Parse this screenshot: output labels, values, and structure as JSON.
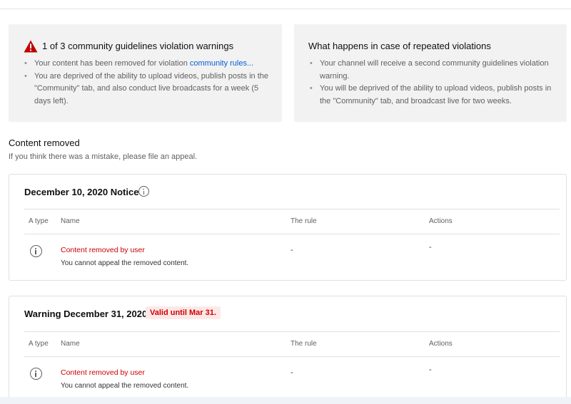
{
  "warning_box": {
    "title": "1 of 3 community guidelines violation warnings",
    "bullet1_text": "Your content has been removed for violation ",
    "bullet1_link": "community rules...",
    "bullet2": "You are deprived of the ability to upload videos, publish posts in the \"Community\" tab, and also conduct live broadcasts for a week (5 days left)."
  },
  "repeat_box": {
    "title": "What happens in case of repeated violations",
    "bullet1": "Your channel will receive a second community guidelines violation warning.",
    "bullet2": "You will be deprived of the ability to upload videos, publish posts in the \"Community\" tab, and broadcast live for two weeks."
  },
  "content_removed": {
    "title": "Content removed",
    "subtitle": "If you think there was a mistake, please file an appeal."
  },
  "table_headers": {
    "type": "A type",
    "name": "Name",
    "rule": "The rule",
    "actions": "Actions"
  },
  "notices": [
    {
      "title": "December 10, 2020 Notice",
      "row": {
        "title": "Content removed by user",
        "subtitle": "You cannot appeal the removed content.",
        "rule": "-",
        "actions": "-"
      }
    },
    {
      "title": "Warning December 31, 2020",
      "badge": "Valid until Mar 31.",
      "row": {
        "title": "Content removed by user",
        "subtitle": "You cannot appeal the removed content.",
        "rule": "-",
        "actions": "-"
      }
    }
  ],
  "icons": {
    "warning": "warning-triangle-icon",
    "info": "info-circle-icon"
  },
  "colors": {
    "link": "#065fd4",
    "error_red": "#cc0000",
    "badge_bg": "#fde8e8",
    "warning_icon": "#c00000"
  }
}
